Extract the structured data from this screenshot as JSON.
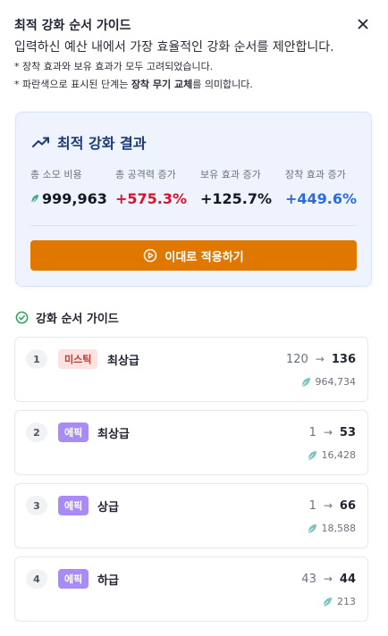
{
  "header": {
    "title": "최적 강화 순서 가이드",
    "subtitle": "입력하신 예산 내에서 가장 효율적인 강화 순서를 제안합니다.",
    "note1": "* 장착 효과와 보유 효과가 모두 고려되었습니다.",
    "note2_prefix": "* 파란색으로 표시된 단계는 ",
    "note2_bold": "장착 무기 교체",
    "note2_suffix": "를 의미합니다."
  },
  "result": {
    "title": "최적 강화 결과",
    "stats": [
      {
        "label": "총 소모 비용",
        "value": "999,963",
        "color": "#111827"
      },
      {
        "label": "총 공격력 증가",
        "value": "+575.3%",
        "color": "#d7142b"
      },
      {
        "label": "보유 효과 증가",
        "value": "+125.7%",
        "color": "#111827"
      },
      {
        "label": "장착 효과 증가",
        "value": "+449.6%",
        "color": "#2a6ce0"
      }
    ],
    "apply_label": "이대로 적용하기"
  },
  "guide": {
    "title": "강화 순서 가이드",
    "steps": [
      {
        "num": "1",
        "tier": "미스틱",
        "tier_type": "mystic",
        "grade": "최상급",
        "from": "120",
        "to": "136",
        "cost": "964,734"
      },
      {
        "num": "2",
        "tier": "에픽",
        "tier_type": "epic",
        "grade": "최상급",
        "from": "1",
        "to": "53",
        "cost": "16,428"
      },
      {
        "num": "3",
        "tier": "에픽",
        "tier_type": "epic",
        "grade": "상급",
        "from": "1",
        "to": "66",
        "cost": "18,588"
      },
      {
        "num": "4",
        "tier": "에픽",
        "tier_type": "epic",
        "grade": "하급",
        "from": "43",
        "to": "44",
        "cost": "213"
      }
    ]
  },
  "icons": {
    "close": "close-icon",
    "trend": "trending-up-icon",
    "play": "play-circle-icon",
    "check": "check-circle-icon",
    "feather": "feather-icon"
  },
  "colors": {
    "accent_orange": "#e07800",
    "title_blue": "#1d3a7a",
    "positive_red": "#d7142b",
    "positive_blue": "#2a6ce0",
    "check_green": "#2e9e5b",
    "feather_teal": "#4aa3a0"
  }
}
